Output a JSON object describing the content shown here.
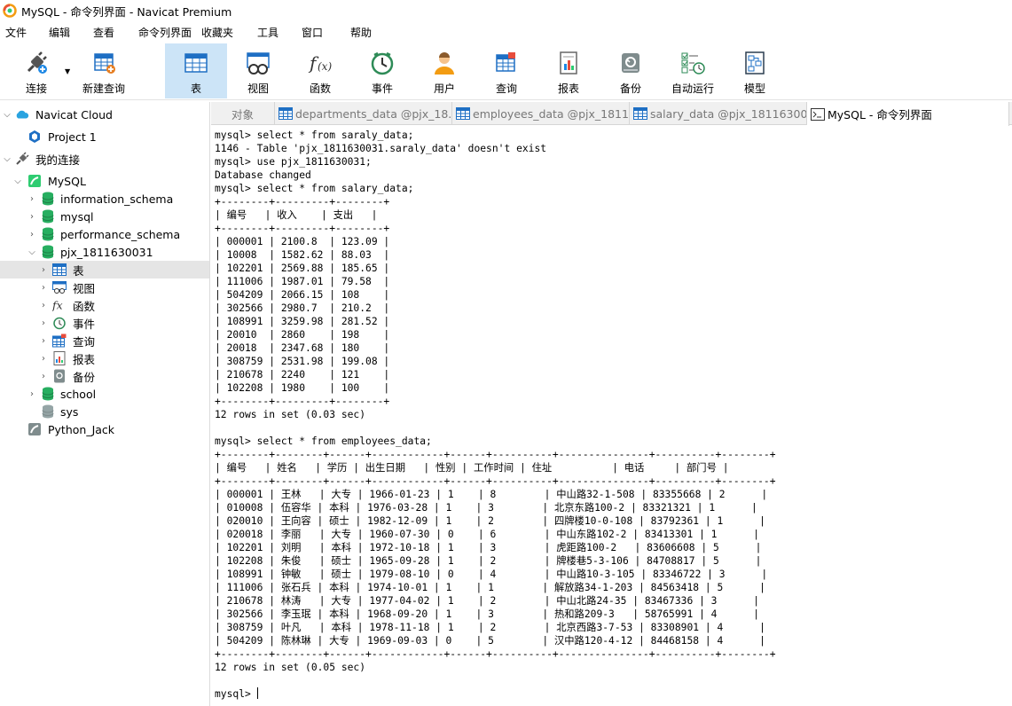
{
  "window": {
    "title": "MySQL - 命令列界面 - Navicat Premium"
  },
  "menu": [
    "文件",
    "编辑",
    "查看",
    "命令列界面",
    "收藏夹",
    "工具",
    "窗口",
    "帮助"
  ],
  "toolbar": {
    "connect": "连接",
    "new_query": "新建查询",
    "table": "表",
    "view": "视图",
    "function": "函数",
    "event": "事件",
    "user": "用户",
    "query": "查询",
    "report": "报表",
    "backup": "备份",
    "automation": "自动运行",
    "model": "模型"
  },
  "sidebar": {
    "navicat_cloud": "Navicat Cloud",
    "project": "Project 1",
    "my_connections": "我的连接",
    "mysql": "MySQL",
    "dbs": [
      "information_schema",
      "mysql",
      "performance_schema",
      "pjx_1811630031"
    ],
    "children": [
      "表",
      "视图",
      "函数",
      "事件",
      "查询",
      "报表",
      "备份"
    ],
    "school": "school",
    "sys": "sys",
    "python_jack": "Python_Jack"
  },
  "tabs": {
    "objects": "对象",
    "t1": "departments_data @pjx_18...",
    "t2": "employees_data @pjx_1811...",
    "t3": "salary_data @pjx_18116300...",
    "t4": "MySQL - 命令列界面"
  },
  "console": {
    "lines": [
      "mysql> select * from saraly_data;",
      "1146 - Table 'pjx_1811630031.saraly_data' doesn't exist",
      "mysql> use pjx_1811630031;",
      "Database changed",
      "mysql> select * from salary_data;",
      "+--------+---------+--------+",
      "| 编号   | 收入    | 支出   |",
      "+--------+---------+--------+",
      "| 000001 | 2100.8  | 123.09 |",
      "| 10008  | 1582.62 | 88.03  |",
      "| 102201 | 2569.88 | 185.65 |",
      "| 111006 | 1987.01 | 79.58  |",
      "| 504209 | 2066.15 | 108    |",
      "| 302566 | 2980.7  | 210.2  |",
      "| 108991 | 3259.98 | 281.52 |",
      "| 20010  | 2860    | 198    |",
      "| 20018  | 2347.68 | 180    |",
      "| 308759 | 2531.98 | 199.08 |",
      "| 210678 | 2240    | 121    |",
      "| 102208 | 1980    | 100    |",
      "+--------+---------+--------+",
      "12 rows in set (0.03 sec)",
      "",
      "mysql> select * from employees_data;",
      "+--------+--------+------+------------+------+----------+---------------+----------+--------+",
      "| 编号   | 姓名   | 学历 | 出生日期   | 性别 | 工作时间 | 住址          | 电话     | 部门号 |",
      "+--------+--------+------+------------+------+----------+---------------+----------+--------+",
      "| 000001 | 王林   | 大专 | 1966-01-23 | 1    | 8        | 中山路32-1-508 | 83355668 | 2      |",
      "| 010008 | 伍容华 | 本科 | 1976-03-28 | 1    | 3        | 北京东路100-2 | 83321321 | 1      |",
      "| 020010 | 王向容 | 硕士 | 1982-12-09 | 1    | 2        | 四牌楼10-0-108 | 83792361 | 1      |",
      "| 020018 | 李丽   | 大专 | 1960-07-30 | 0    | 6        | 中山东路102-2 | 83413301 | 1      |",
      "| 102201 | 刘明   | 本科 | 1972-10-18 | 1    | 3        | 虎距路100-2   | 83606608 | 5      |",
      "| 102208 | 朱俊   | 硕士 | 1965-09-28 | 1    | 2        | 牌楼巷5-3-106 | 84708817 | 5      |",
      "| 108991 | 钟敏   | 硕士 | 1979-08-10 | 0    | 4        | 中山路10-3-105 | 83346722 | 3      |",
      "| 111006 | 张石兵 | 本科 | 1974-10-01 | 1    | 1        | 解放路34-1-203 | 84563418 | 5      |",
      "| 210678 | 林涛   | 大专 | 1977-04-02 | 1    | 2        | 中山北路24-35 | 83467336 | 3      |",
      "| 302566 | 李玉珉 | 本科 | 1968-09-20 | 1    | 3        | 热和路209-3   | 58765991 | 4      |",
      "| 308759 | 叶凡   | 本科 | 1978-11-18 | 1    | 2        | 北京西路3-7-53 | 83308901 | 4      |",
      "| 504209 | 陈林琳 | 大专 | 1969-09-03 | 0    | 5        | 汉中路120-4-12 | 84468158 | 4      |",
      "+--------+--------+------+------------+------+----------+---------------+----------+--------+",
      "12 rows in set (0.05 sec)",
      "",
      "mysql> "
    ]
  }
}
